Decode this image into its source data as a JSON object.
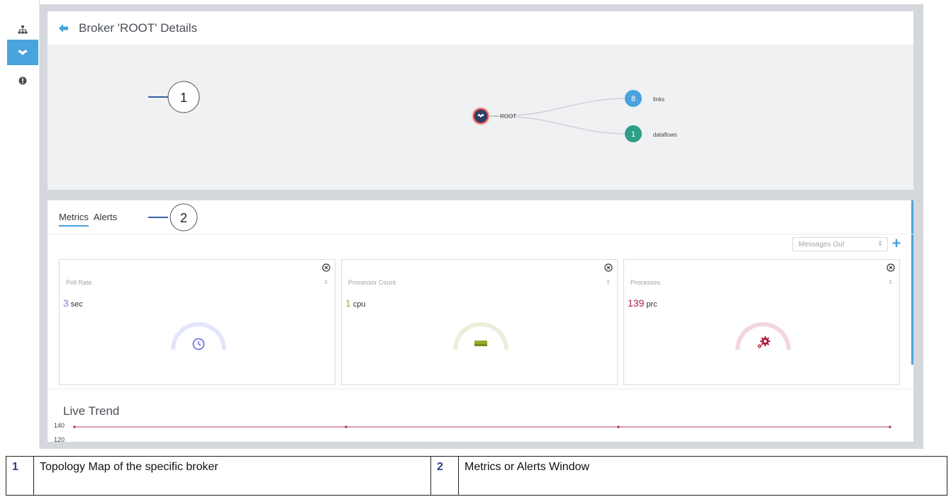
{
  "header": {
    "title": "Broker 'ROOT' Details"
  },
  "rail": {
    "icons": [
      "topology-icon",
      "broker-icon",
      "alert-icon"
    ],
    "active_index": 1
  },
  "topology": {
    "root_label": "ROOT",
    "nodes": [
      {
        "count": "8",
        "label": "links",
        "color": "#4aa3df"
      },
      {
        "count": "1",
        "label": "dataflows",
        "color": "#2f9e86"
      }
    ]
  },
  "callouts": {
    "first": "1",
    "second": "2"
  },
  "tabs": [
    {
      "label": "Metrics",
      "active": true
    },
    {
      "label": "Alerts",
      "active": false
    }
  ],
  "metric_select": {
    "value": "Messages Out"
  },
  "cards": [
    {
      "label": "Poll Rate",
      "value": "3",
      "unit": "sec",
      "color": "#7b84e0",
      "icon": "clock-icon"
    },
    {
      "label": "Processor Count",
      "value": "1",
      "unit": "cpu",
      "color": "#9ab53a",
      "icon": "cpu-icon"
    },
    {
      "label": "Processes",
      "value": "139",
      "unit": "prc",
      "color": "#b0203e",
      "icon": "gears-icon"
    }
  ],
  "live_trend": {
    "title": "Live Trend",
    "ticks": [
      "140",
      "120"
    ],
    "line_color": "#b8405e"
  },
  "legend": [
    {
      "number": "1",
      "text": "Topology Map of the specific broker"
    },
    {
      "number": "2",
      "text": "Metrics or Alerts Window"
    }
  ]
}
